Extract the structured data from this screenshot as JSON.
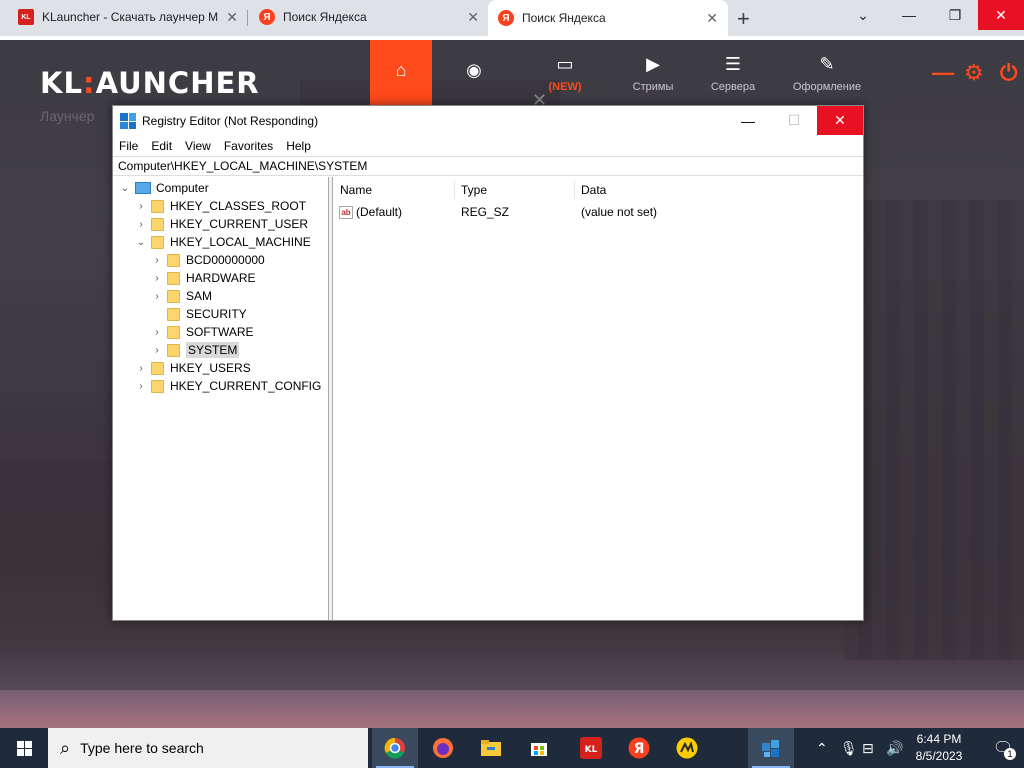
{
  "browser": {
    "tabs": [
      {
        "label": "KLauncher - Скачать лаунчер М",
        "favicon": "KL",
        "active": false
      },
      {
        "label": "Поиск Яндекса",
        "favicon": "Я",
        "active": false
      },
      {
        "label": "Поиск Яндекса",
        "favicon": "Я",
        "active": true
      }
    ],
    "new_tab": "+",
    "controls": {
      "dropdown": "⌄",
      "minimize": "—",
      "restore": "❐",
      "close": "✕"
    }
  },
  "launcher": {
    "logo_left": "KL",
    "logo_colon": ":",
    "logo_right": "AUNCHER",
    "subtitle": "Лаунчер",
    "nav": [
      {
        "label": "",
        "icon": "home-icon"
      },
      {
        "label": "",
        "icon": "gamepad-icon"
      },
      {
        "label": "(NEW)",
        "icon": "inbox-icon"
      },
      {
        "label": "Стримы",
        "icon": "play-icon"
      },
      {
        "label": "Сервера",
        "icon": "server-icon"
      },
      {
        "label": "Оформление",
        "icon": "brush-icon"
      }
    ],
    "accent": "#ff4a1c"
  },
  "regedit": {
    "title": "Registry Editor (Not Responding)",
    "menu": [
      "File",
      "Edit",
      "View",
      "Favorites",
      "Help"
    ],
    "address": "Computer\\HKEY_LOCAL_MACHINE\\SYSTEM",
    "tree": [
      {
        "label": "Computer",
        "level": 0,
        "expander": "⌄",
        "type": "pc"
      },
      {
        "label": "HKEY_CLASSES_ROOT",
        "level": 1,
        "expander": "›",
        "type": "folder"
      },
      {
        "label": "HKEY_CURRENT_USER",
        "level": 1,
        "expander": "›",
        "type": "folder"
      },
      {
        "label": "HKEY_LOCAL_MACHINE",
        "level": 1,
        "expander": "⌄",
        "type": "folder"
      },
      {
        "label": "BCD00000000",
        "level": 2,
        "expander": "›",
        "type": "folder"
      },
      {
        "label": "HARDWARE",
        "level": 2,
        "expander": "›",
        "type": "folder"
      },
      {
        "label": "SAM",
        "level": 2,
        "expander": "›",
        "type": "folder"
      },
      {
        "label": "SECURITY",
        "level": 2,
        "expander": "",
        "type": "folder"
      },
      {
        "label": "SOFTWARE",
        "level": 2,
        "expander": "›",
        "type": "folder"
      },
      {
        "label": "SYSTEM",
        "level": 2,
        "expander": "›",
        "type": "folder",
        "selected": true
      },
      {
        "label": "HKEY_USERS",
        "level": 1,
        "expander": "›",
        "type": "folder"
      },
      {
        "label": "HKEY_CURRENT_CONFIG",
        "level": 1,
        "expander": "›",
        "type": "folder"
      }
    ],
    "columns": [
      "Name",
      "Type",
      "Data"
    ],
    "values": [
      {
        "name": "(Default)",
        "type": "REG_SZ",
        "data": "(value not set)",
        "icon": "ab"
      }
    ]
  },
  "taskbar": {
    "search_placeholder": "Type here to search",
    "apps": [
      "chrome-icon",
      "firefox-icon",
      "file-explorer-icon",
      "store-icon",
      "klauncher-icon",
      "yandex-icon",
      "yandex-music-icon",
      "regedit-icon"
    ],
    "time": "6:44 PM",
    "date": "8/5/2023",
    "notification_count": "1"
  }
}
